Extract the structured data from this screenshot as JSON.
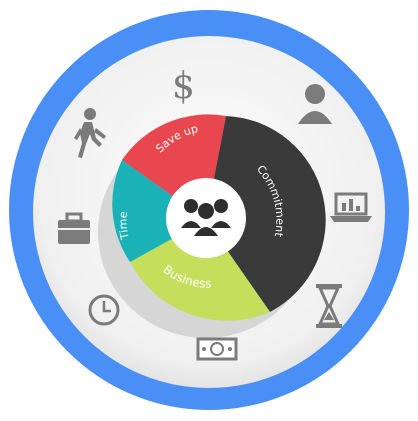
{
  "diagram": {
    "segments": [
      {
        "label": "Save up",
        "color": "#e8474f"
      },
      {
        "label": "Commitment",
        "color": "#3a3a3a"
      },
      {
        "label": "Business",
        "color": "#c5de5b"
      },
      {
        "label": "Time",
        "color": "#1ab1b7"
      }
    ],
    "colors": {
      "ring": "#4a8ff5",
      "disc": "#f2f2f2",
      "icon": "#7b7b7b",
      "center": "#ffffff",
      "center_icon": "#2e2e2e"
    },
    "icons": [
      "dollar-icon",
      "user-icon",
      "laptop-chart-icon",
      "hourglass-icon",
      "money-icon",
      "clock-icon",
      "briefcase-icon",
      "walking-person-icon"
    ],
    "center_icon": "team-icon"
  }
}
